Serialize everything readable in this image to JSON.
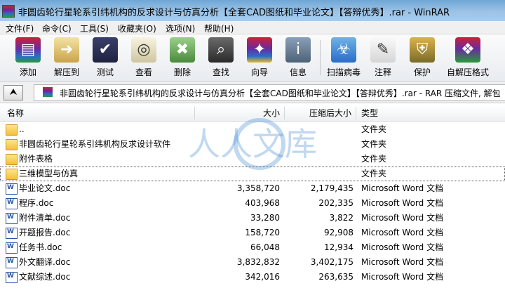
{
  "window": {
    "title": "非圆齿轮行星轮系引纬机构的反求设计与仿真分析【全套CAD图纸和毕业论文】【答辩优秀】.rar - WinRAR"
  },
  "menu": [
    "文件(F)",
    "命令(C)",
    "工具(S)",
    "收藏夹(O)",
    "选项(N)",
    "帮助(H)"
  ],
  "toolbar": [
    {
      "label": "添加",
      "icon": "add-archive-icon"
    },
    {
      "label": "解压到",
      "icon": "extract-to-icon"
    },
    {
      "label": "测试",
      "icon": "test-icon"
    },
    {
      "label": "查看",
      "icon": "view-icon"
    },
    {
      "label": "删除",
      "icon": "delete-icon"
    },
    {
      "label": "查找",
      "icon": "find-icon"
    },
    {
      "label": "向导",
      "icon": "wizard-icon"
    },
    {
      "label": "信息",
      "icon": "info-icon"
    },
    {
      "label": "扫描病毒",
      "icon": "virus-scan-icon"
    },
    {
      "label": "注释",
      "icon": "comment-icon"
    },
    {
      "label": "保护",
      "icon": "protect-icon"
    },
    {
      "label": "自解压格式",
      "icon": "sfx-icon"
    }
  ],
  "path": {
    "text": "非圆齿轮行星轮系引纬机构的反求设计与仿真分析【全套CAD图纸和毕业论文】【答辩优秀】.rar - RAR 压缩文件, 解包"
  },
  "columns": {
    "name": "名称",
    "size": "大小",
    "packed": "压缩后大小",
    "type": "类型"
  },
  "files": [
    {
      "name": "..",
      "size": "",
      "packed": "",
      "type": "文件夹",
      "kind": "folder"
    },
    {
      "name": "非圆齿轮行星轮系引纬机构反求设计软件",
      "size": "",
      "packed": "",
      "type": "文件夹",
      "kind": "folder"
    },
    {
      "name": "附件表格",
      "size": "",
      "packed": "",
      "type": "文件夹",
      "kind": "folder"
    },
    {
      "name": "三维模型与仿真",
      "size": "",
      "packed": "",
      "type": "文件夹",
      "kind": "folder"
    },
    {
      "name": "毕业论文.doc",
      "size": "3,358,720",
      "packed": "2,179,435",
      "type": "Microsoft Word 文档",
      "kind": "doc"
    },
    {
      "name": "程序.doc",
      "size": "403,968",
      "packed": "202,335",
      "type": "Microsoft Word 文档",
      "kind": "doc"
    },
    {
      "name": "附件清单.doc",
      "size": "33,280",
      "packed": "3,822",
      "type": "Microsoft Word 文档",
      "kind": "doc"
    },
    {
      "name": "开题报告.doc",
      "size": "158,720",
      "packed": "92,908",
      "type": "Microsoft Word 文档",
      "kind": "doc"
    },
    {
      "name": "任务书.doc",
      "size": "66,048",
      "packed": "12,934",
      "type": "Microsoft Word 文档",
      "kind": "doc"
    },
    {
      "name": "外文翻译.doc",
      "size": "3,832,832",
      "packed": "3,402,175",
      "type": "Microsoft Word 文档",
      "kind": "doc"
    },
    {
      "name": "文献综述.doc",
      "size": "342,016",
      "packed": "263,635",
      "type": "Microsoft Word 文档",
      "kind": "doc"
    }
  ],
  "watermark": {
    "text": "人人文库",
    "color": "#4a8fd4"
  }
}
